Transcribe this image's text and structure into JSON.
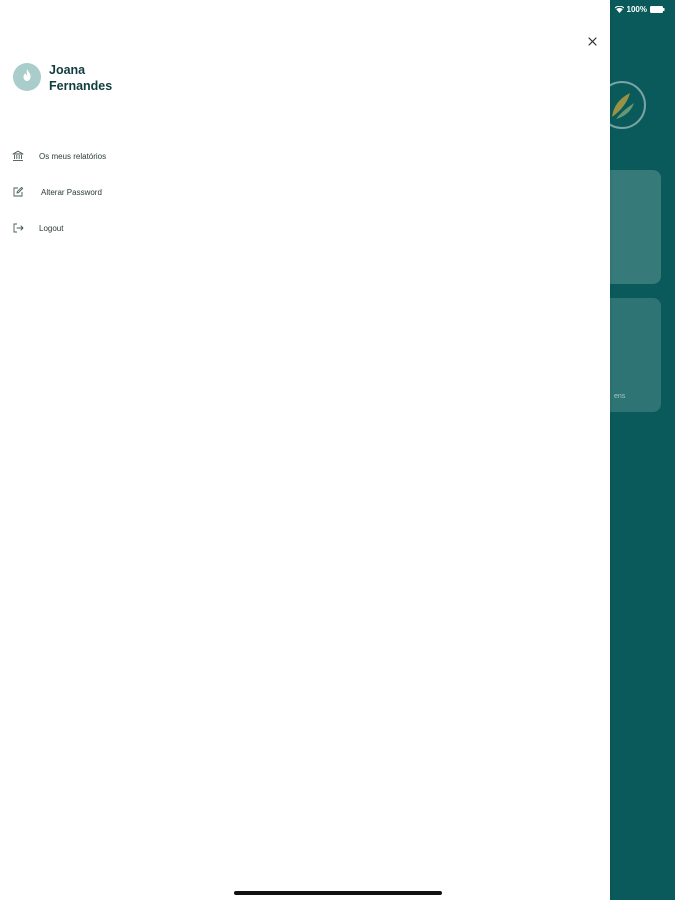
{
  "status_bar": {
    "battery_text": "100%",
    "icons": [
      "wifi-icon",
      "battery-icon"
    ]
  },
  "background": {
    "card_text": "ens"
  },
  "drawer": {
    "user": {
      "name": "Joana Fernandes",
      "avatar_icon": "flame-icon"
    },
    "close_icon": "close-icon",
    "menu": [
      {
        "label": "Os meus relatórios",
        "icon": "bank-icon"
      },
      {
        "label": "Alterar Password",
        "icon": "edit-icon"
      },
      {
        "label": "Logout",
        "icon": "logout-icon"
      }
    ]
  },
  "colors": {
    "background_teal": "#0b5a5b",
    "avatar": "#a9cdca",
    "name_text": "#123d3f"
  }
}
